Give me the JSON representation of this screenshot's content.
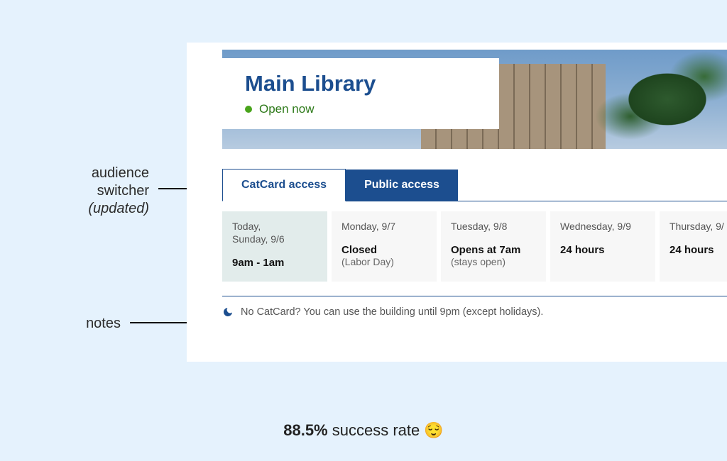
{
  "annotations": {
    "switcher_line1": "audience",
    "switcher_line2": "switcher",
    "switcher_sub": "(updated)",
    "notes": "notes"
  },
  "header": {
    "title": "Main Library",
    "status_text": "Open now"
  },
  "tabs": {
    "active": "CatCard access",
    "inactive": "Public access"
  },
  "days": [
    {
      "label_a": "Today,",
      "label_b": "Sunday, 9/6",
      "main": "9am - 1am",
      "sub": ""
    },
    {
      "label_a": "Monday, 9/7",
      "label_b": "",
      "main": "Closed",
      "sub": "(Labor Day)"
    },
    {
      "label_a": "Tuesday, 9/8",
      "label_b": "",
      "main": "Opens at 7am",
      "sub": "(stays open)"
    },
    {
      "label_a": "Wednesday, 9/9",
      "label_b": "",
      "main": "24 hours",
      "sub": ""
    },
    {
      "label_a": "Thursday, 9/",
      "label_b": "",
      "main": "24 hours",
      "sub": ""
    }
  ],
  "note": "No CatCard? You can use the building until 9pm (except holidays).",
  "caption": {
    "bold": "88.5%",
    "rest": " success rate ",
    "emoji": "😌"
  }
}
